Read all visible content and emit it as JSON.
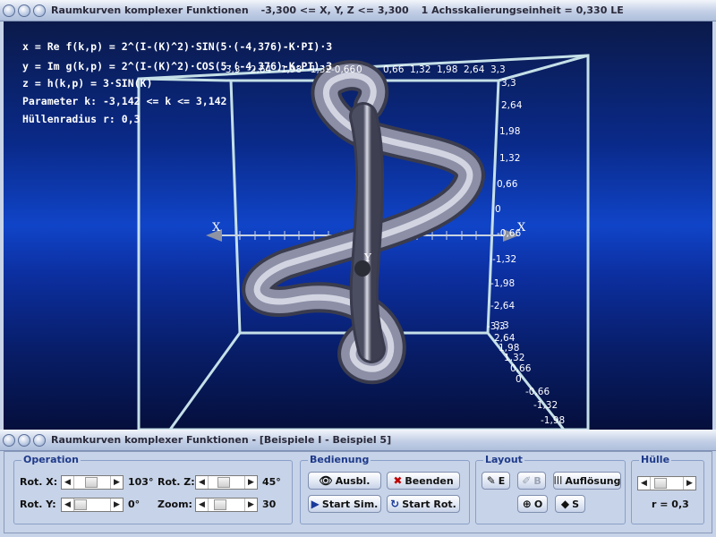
{
  "window_top": {
    "title": "Raumkurven komplexer Funktionen",
    "range": "-3,300 <= X, Y, Z <= 3,300",
    "scale": "1 Achsskalierungseinheit = 0,330 LE"
  },
  "formulas": [
    "x = Re f(k,p) = 2^(I-(K)^2)·SIN(5·(-4,376)-K·PI)·3",
    "y = Im g(k,p) = 2^(I-(K)^2)·COS(5·(-4,376)-K·PI)·3",
    "z = h(k,p) = 3·SIN(K)",
    "Parameter k: -3,142 <= k <= 3,142",
    "Hüllenradius r: 0,3"
  ],
  "axes": {
    "x_label": "X",
    "y_label": "Y",
    "top_ticks": [
      "-3,3",
      "-2,64",
      "-1,98",
      "-1,32",
      "-0,66",
      "0",
      "0,66",
      "1,32",
      "1,98",
      "2,64",
      "3,3"
    ],
    "right_ticks": [
      "3,3",
      "2,64",
      "1,98",
      "1,32",
      "0,66",
      "0",
      "-0,66",
      "-1,32",
      "-1,98",
      "-2,64",
      "-3,3"
    ],
    "diag_ticks": [
      "3,3",
      "2,64",
      "1,98",
      "1,32",
      "0,66",
      "0",
      "-0,66",
      "-1,32",
      "-1,98"
    ]
  },
  "window_bottom": {
    "title": "Raumkurven komplexer Funktionen - [Beispiele I - Beispiel 5]"
  },
  "operation": {
    "title": "Operation",
    "rot_x_label": "Rot. X:",
    "rot_x_value": "103°",
    "rot_z_label": "Rot. Z:",
    "rot_z_value": "45°",
    "rot_y_label": "Rot. Y:",
    "rot_y_value": "0°",
    "zoom_label": "Zoom:",
    "zoom_value": "30"
  },
  "bedienung": {
    "title": "Bedienung",
    "ausbl": "Ausbl.",
    "beenden": "Beenden",
    "start_sim": "Start Sim.",
    "start_rot": "Start Rot."
  },
  "layout": {
    "title": "Layout",
    "e_btn": "E",
    "b_btn": "B",
    "aufloesung": "Auflösung",
    "o_btn": "O",
    "s_btn": "S"
  },
  "huelle": {
    "title": "Hülle",
    "value": "r = 0,3"
  },
  "colors": {
    "accent": "#1e3a8a",
    "frame": "#c5e0e8",
    "tube": "#8c8fa6"
  }
}
